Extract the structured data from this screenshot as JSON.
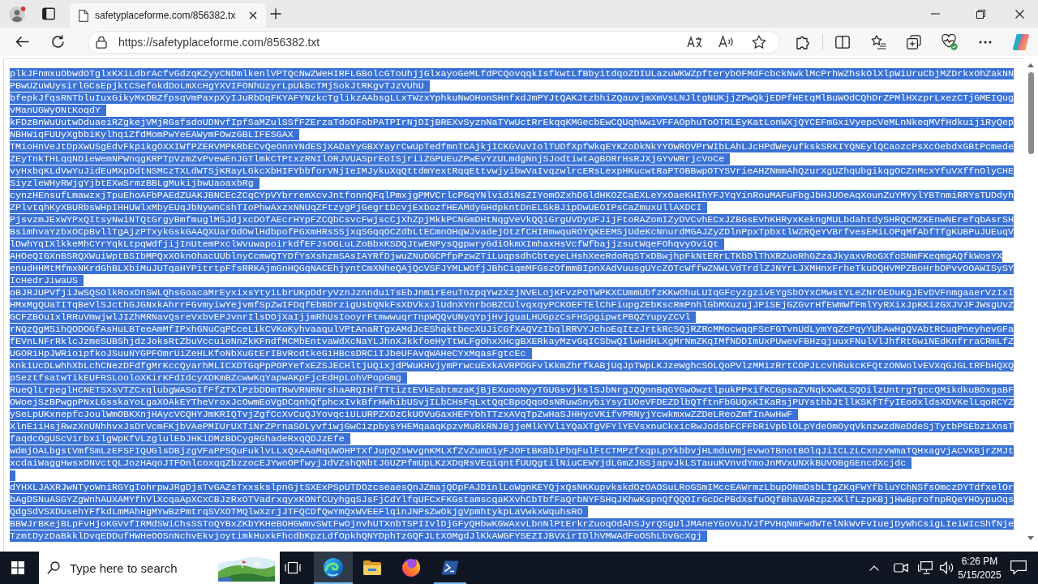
{
  "browser": {
    "tabs": [
      {
        "title": "safetyplaceforme.com/856382.tx",
        "selected": true
      }
    ],
    "address_bar": {
      "url": "https://safetyplaceforme.com/856382.txt"
    }
  },
  "document": {
    "lines": [
      {
        "kind": "text",
        "selected": true,
        "rows": [
          "plkJFnmxuObwdOTglxKXiLdbrAcfvGdzqKZyyCNDmlkenlVPTQcNwZWeHIRFLGBolcGToUhjjGlxayoGeMLfdPCQovqqkIsfkwtLfBbyitdqoZDIULazuWKWZpfterybOFMdFcbckNwklMcPrhWZhskOlXlpWiUruCbjMZDrkxOhZakNN",
          "PBwUZuWUysirlGCsEpjktCSefokdDoLmXcHgYXVIFONhUzyrLpUkBcTMjSokJtRKgvTJzVUhU"
        ]
      },
      {
        "kind": "text",
        "selected": true,
        "rows": [
          "bfepkJfqsRNTbluIuxGikyMxDBZfpsqVmPaxpXyIJuRbDqFKYAFYNzkcTglikzAAbsgLLxTWzxYphkuNwOHonSHnfxdJmPYJtQAKJtzbhiZQauvjmXmVsLNJltgNUKjjZPwQkjEDPfHEtqMlBuWOdCQhDrZPMlHXzprLxezCTjGMEIQug",
          "vManUGWyONtKoqdY"
        ]
      },
      {
        "kind": "text",
        "selected": true,
        "rows": [
          "kFDzBnWuUutwDduaeiRZgkejVMjRGsfsdoUDNvfIpfSaMZulSSfFZErzaTdoDFobPATPIrNjDIjBREXvSyznNaTYwUctRrEkqqKMGecbEwCQUqhWwiVFFAOphuToOTRLEyKatLonWXjQYCEFmGxiVyepcVeMLnNkeqMVfHdkuijiRyQep",
          "NBHWiqFUUyXgbbiKylhqiZfdMomPwYeEAWymFOwzGBLIFESGAX"
        ]
      },
      {
        "kind": "text",
        "selected": true,
        "rows": [
          "TMioHnVeJtDpXwUSgEdvFkpikgOXXIWfPZERVMPKRbECvQeOnnYNdESjXADaYyGBXYayrCwUpTedfmnTCAjkjICKGVuVIolTUDfXpfWkqEYKZoDkNkYYOWROVPrWIbLAhLJcHPdWeyufkskSRKIYQNEylQCaozcPsXcOebdxGBtPcmede",
          "ZEyTnkTHLqqNDieWemNPWnqgKRPTpVzmZvPvewEnJGTlmkCTPtxzRNIlORJVUASprEoISjriiZGPUEuZPwEvYzULmdgNnjSJodtiwtAgBORrHsRJXjGYvWRrjcVoCe"
        ]
      },
      {
        "kind": "text",
        "selected": true,
        "rows": [
          "vyHxbqKLdVwYuJidEuMXpDdtNSMCzTXLdWTSjKRayLGkcXbHIFYbbforVNjIeIMJykuXqQttdmYextRqqEttvwjyibwVaIvqzwlrcERsLexpHKucwtRaPTOBBwpOTYSVrieAHZNmmAhQzurXgUZhqUbgikqgOCZnMcxYfuVXffnOlyCHE",
          "SiyzleWHyRWjgYjbtEXwSrmzBBLgMukijbwUaoaxbRg"
        ]
      },
      {
        "kind": "text",
        "selected": true,
        "rows": [
          "cynzHEnsufLmawzxjTpuEhoAFbPAEdZUAKJBNCEcZCqCYpVYbrremXcvJntfonnQFqlPmxjgPMVCrlcPGqYNlvidiNsZIYomOZxhDGldHKOZCaEXLeYxOaeKHIhYFJYqYinRouMAFuFbgJbHJUOeAqXounZuYMYylYBTnmiRRYsTUDdyh",
          "ZPlvtqhKyXBURbsWHpIHHUWlxMbyEUqJbNywnCshTIoPhwAxzxNNUqZFtzygPjGegrtDcvjExbozfHEAMdyGHdpkntDnELSkBJipDwUEOIPsCaZmuxUllAXDCI"
        ]
      },
      {
        "kind": "text",
        "selected": true,
        "rows": [
          "PjsvzmJExWYPxQItsyNwiNTQtGrgyBmfmuglMSJdjxcDOfAEcrHYpFZCQbCsvcFwjscCjXhZpjMkkPCNGmDHtNqgVeVkQQiGrgUVDyUFJijFtoRAZomIZyDVCvhECxJZBGsEvhKHRyxKekngMULbdahtdySHRQCMZKEnwNErefqbAsrSH",
          "BsimhvaYzbxOCpBvllTgAjzPTxykGskGAAQXUarOdOwlHdbpofPGXmHRsSSjxqSGqqOCZdbLtECmnOHqWJvadejOtzfCHIRmwquROYQKEEMSjUdeKcNnurdMGAJZyZDlnPpxTpbxtlWZRQeYVBrfvesEMiLOPqMfAbfTfgKUBPuJUEuqV",
          "lDwhYqIXlkkeMhCYrYqkLtpqWdfjijInUtemPxclWvuwapoirkdfEFJsOGLuLZoBbxKSDQJtwENPysQgpwryGdiOkmXImhaxHsVcfWfbajjzsutWqeFOhqvyOviQt"
        ]
      },
      {
        "kind": "text",
        "selected": true,
        "rows": [
          "AHOeQIGXnBSRQXWuiWptBSIbMPQxXOknOhacUUblnyCcmwQTYDfYsXshzmSAsIAYRfDjwuZNuDGCPfpPzwZTiLuqpsdhCbteyeLHshXeeRdoRqSTxDBwjhpFkNtERrLTKbDlThXRZuoRhGZzaJkyaxvRoGXfoSNmFKeqmgAQfkWosYX",
          "enudHHMtMfmxNKrdGhBLXbiMuJUTqaHYPitrtpFfsRRKAjmGnHQGqNACEhjyntCmXNheQAjQcVSFJYMLWOfjJBhCiqmMFGszOfmmBIpnXAdVuusgUYcZOTcWffwZNWLVdTrdlZJNYrLJXMHnxFrheTkuDQHVMPZBoHrbDPvvOOAWISySY",
          "IcHedrJiwaUS"
        ]
      },
      {
        "kind": "text",
        "selected": true,
        "rows": [
          "oBJRJUPVfjiJwSQSOlkRoxDnSWLQhsGoacaMrEyxixsYtyiLbrUKpDdryVznJznnduiTsEbJnmirEeuTnzpqYwzXzjNVELojKFvzPOTWPKXCUmmUbfzKKwOhuLUIqGFcyzgzivEYgSbOYxCMwstYLeZNrOEDuKgJEvDVFnmgaaerVzIxI",
          "HMxMgQUaTITqBeVlSJcthGJGNxkAhrrFGvmyiwYejvmfSpZwIFDqfEbBDrzigUsbQNkFsXDVkxJlUdnXYnrboBZCUlvqxqyPCKOEFTElChFiupgZEbKscRmPnhlGbMXuzujJPiSEjGZGvrHfEWmWfFmlYyRXixJpKKizGXJVJFJWsgUvZ",
          "GCFZBOuIxlRRuVmwjwlJIZhMRNavQsreVxbvEPJvnrIlsDOjXaIjjmRhUsIooyrFtmwwuqrTnpWQQvUNyqYpjHvjguaLHUGpzCsFHSpgipwtPBQZYupyZCVl"
        ]
      },
      {
        "kind": "text",
        "selected": true,
        "rows": [
          "rNQzQgMSihQODOGfAsHuLBTeeAmMfIPxhGNuCqPCceLikCVKoKyhvaaqulVPtAnaRTgxAMdJcEShqktbecXUJiCGfXAQVzIbqlRRVYJchoEqItzJrtkRcSQjRZRcMMocwqqFScFGTvnUdLymYqZcPqyYUhAwHgQVAbtRCuqPneyhevGFa",
          "fEVnLNFrRklcJzmeSUBShjdzJoksRtZbuVccuioNnZkKFndfMCMbEntvaWdXcNaYLJhnXJkkfoeHyTtWLFgOhxXHcgBXERkayMzvGqICSbwQIlwHdHLXgMrNmZKqIMfNDDImUxPUwevFBHzqjuuxFNulVlJhfRtGwiNEdKnfrraCRmLfZ",
          "UGORiHpJWRioipfkoJSuuNYGPFOmrUiZeHLKfoNbXuGtErIBvRcdtkeGiHBcsDRCiIJbeUFAvqWAHeCYxMqasFgtcEc"
        ]
      },
      {
        "kind": "text",
        "selected": true,
        "rows": [
          "XnkiUcDLwhhXbLchCNezDFdfgMrKccQyarhMLICXDTGqPpPOPYefxEZSJECHltjUQixjdPWuKHvjymPrwcuExkAVRPDGFvlKkmZhrfkABjUqJpTWpLKJzeWghcSOLQoPVlzMMizRrtCOPJLcvhRukcKFQtzONWolvEVXqGJGLtRFbHQXQ",
          "pSeztfsatwTikEUFRSLooloXKirKFdIdcyXDKmBZcwwKqYapwAKpFjcEdHpLohVPopGmg"
        ]
      },
      {
        "kind": "text",
        "selected": true,
        "rows": [
          "RueQlLrpeglHCNETSXsVTZCxqlubgWASoIfFfZTXlPzbDDmTRwVRNRNrshaARQIHfTTtiztEVkEabtmzaKjBjEXuooNyyTGUGsvjkslSJbNrgJQQnnBqGYGwOwztlpukPPxifKCGpsaZVNqkXwKLSQOilzUntrgTgccQMikdkuBOxgaBF",
          "OWoejSzBPwgpPNxLGsskaYoLgaXOAkEYTheVroxJcOwmEoVgDCqnhQfphcxIvkBfrHWhibUSvjILbCHsFqLxtQqCBpoQqoOsNRuwSnybiYsyIUOeVFDEZDlbQTftnFbGUQxKIKaRsjPUYsthbJtllKSKfTfyIEodxldsXDVKelLqoRCYZ",
          "ySeLpUKxnepfcJoulWmOBKXnjHAycVCQHYJmKRIQTvjZgfCcXvCuQJYovqciULURPZXDzCkUOVuGaxHEFYbhTTzxAVqTpZwHaSJHHycVKifvPRNyjYcwkmxwZZDeLReoZmfInAwHwF"
        ]
      },
      {
        "kind": "text",
        "selected": true,
        "rows": [
          "XlnEiiHsjRwzXnUNhhvxJsDrVcmFKjbVAePMIUrUXTiNrZPrnaSOLyvfiwjGwCizpbysYHEMqaaqKpzvMuRkRNJBjjeMlkYVliYQaXTgVFYlYEVsxnuCkxicRwJodsbFCFFbRiVpblOLpYdeOmOyqVknzwzdNeDdeSjTytbPSEbziXnsT",
          "faqdcOgUScVirbxilgWpKfVLzglulEbJHKiDMzBDCygRGhadeRxqQDJzEfe"
        ]
      },
      {
        "kind": "text",
        "selected": true,
        "rows": [
          "wdmjOALbgstVmfSmLzEFSFIQUGlsDBjzgVFaPPSQuFuklvLLxQxAAaMqUWOHPTXfJupQZsWvgnKMLXfZvZumDiyFJOFtBKBbiPbqFulFtCTMPzfxqpLpYkbbvjHLmduVmjevwoTBnotBOlqJiICLzLCxnzvWmaTQHxagVjACVKBjrZMJt",
          "xcdaiWaggHwsxONVctQLJozHAqoJTFOnlcoxqqZbzzocEJYwoOPfwyjJdVZshQNbtJGUZPfmUpLKzXDqRsVEqiqntfUUQgtilNiuCEWYjdLGmZJGSjapvJkLSTauuKVnvdYmoJnMVxUNXkBUVOBgGEncdXcjdc"
        ]
      },
      {
        "kind": "blank",
        "selected": true
      },
      {
        "kind": "text",
        "selected": true,
        "rows": [
          "dYHXLJAXRJwNTyoWniRGYgIohrpwJRgDjsTvGAZsTxxskslpnGjtSXExPSpUTDOzcseaesQnJZmajQDpFAJDinlLoWgnKEYQjxQsNKKupvkskdOzOAOSuLRoGSmIMccEAWrmzLbupONmDsbLIgZKqFWYfbluYChNSfsOmczDYTdfxelOr",
          "bAgDSNuASGYZgWnhAUXAMYfhVlXcqaApXCxCBJzRxOTVadrxqyxKONfCUyhgqSJsFjCdYlfqUFCxFKGstamscqaKXvhCbTbfFaQrbNYFSHqJKhwKspnQfQQOIrGcDcPBdXsfuOQfBhaVARzpzXKlfLzpKBjjHwBprofnpRQeYHOypuOqs",
          "QdgSdVSXDUsehYFfkdLmMAhHgMYwBzPmtrqSVXOTMQlwXzrjJTFQCDfQwYmQxWVEEFlqinJNPsZwOkjgVpmhtykpLaVwkxWquhsRO"
        ]
      },
      {
        "kind": "text",
        "selected": true,
        "rows": [
          "BBWJrBKejBLpFvHjoKGVvfIRMdSWiChsSSToQYBxZKbYKHeBOHGWmvSWtFwOjnvhUTXnbTSPIIvlDjGFyQHbwKGWAxvLbnNlPtErkrZuoqOdAhSJyrQSgUlJMAneYGoVuJVJfPVHqNmFwdWTelNkWvFvIuejDyWhCsigLIeiWIcShfNje",
          "TzmtDyzDaBkklDvqEDDufHWHeOOSnNchvEkvjoytimkHuxkFhcdbKpzLdfOpkhQNYDphTzGQFJLtXOMgdJlKkAWGFYSEZIJBVXirIDlhVMWAdFoOShLbvGcXgj"
        ]
      }
    ]
  },
  "taskbar": {
    "search": {
      "placeholder": "Type here to search"
    },
    "apps": [
      {
        "kind": "swirl",
        "selected": true,
        "running": true
      },
      {
        "kind": "folder",
        "selected": false,
        "running": false
      },
      {
        "kind": "globe",
        "selected": false,
        "running": false
      },
      {
        "kind": "terminal",
        "selected": false,
        "running": true
      }
    ],
    "clock": {
      "time": "6:26 PM",
      "date": "5/15/2025"
    }
  }
}
